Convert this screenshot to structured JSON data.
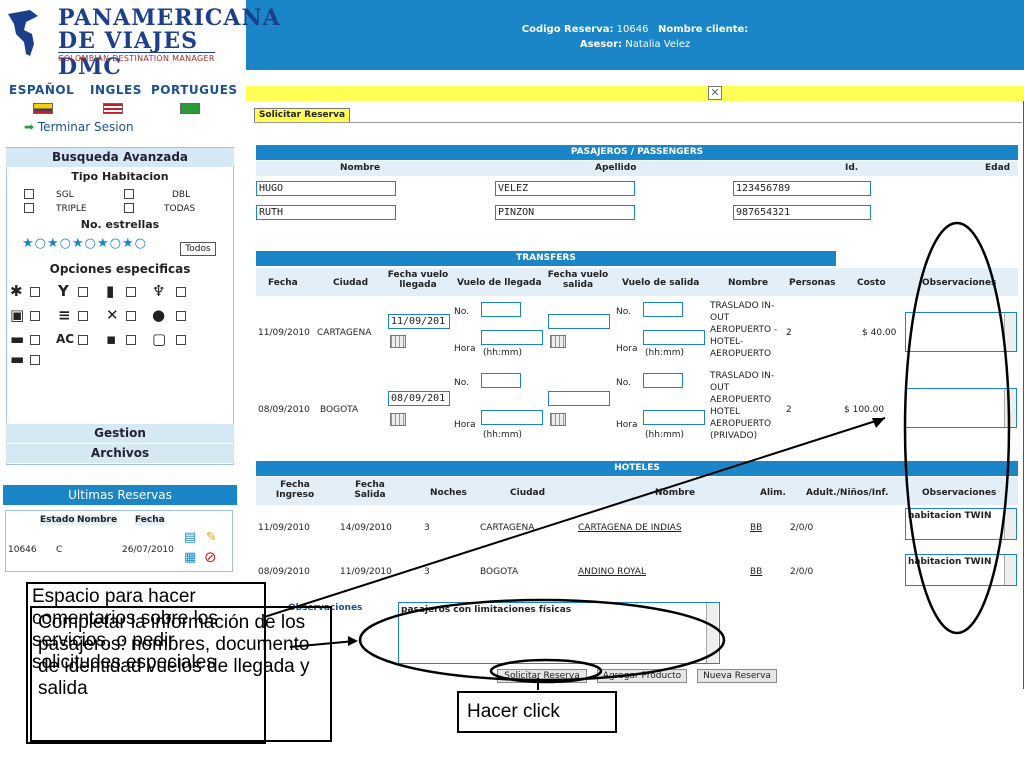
{
  "logo": {
    "line1": "PANAMERICANA",
    "line2": "DE VIAJES DMC",
    "line3": "COLOMBIAN DESTINATION MANAGER"
  },
  "header": {
    "codigo_label": "Codigo Reserva:",
    "codigo_value": "10646",
    "cliente_label": "Nombre cliente:",
    "asesor_label": "Asesor:",
    "asesor_value": "Natalia Velez"
  },
  "languages": [
    "ESPAÑOL",
    "INGLES",
    "PORTUGUES"
  ],
  "terminar": "Terminar Sesion",
  "busqueda": {
    "title": "Busqueda Avanzada",
    "tipo": "Tipo Habitacion",
    "sgl": "SGL",
    "dbl": "DBL",
    "triple": "TRIPLE",
    "todas": "TODAS",
    "estrellas": "No. estrellas",
    "todos": "Todos",
    "opciones": "Opciones especificas",
    "ac": "AC"
  },
  "gestion": "Gestion",
  "archivos": "Archivos",
  "ultimas": {
    "title": "Ultimas Reservas",
    "h_estado": "Estado",
    "h_nombre": "Nombre",
    "h_fecha": "Fecha",
    "id": "10646",
    "estado": "C",
    "fecha": "26/07/2010"
  },
  "tab": "Solicitar Reserva",
  "pasajeros": {
    "title": "PASAJEROS / PASSENGERS",
    "h_nombre": "Nombre",
    "h_apellido": "Apellido",
    "h_id": "Id.",
    "h_edad": "Edad",
    "rows": [
      {
        "nombre": "HUGO",
        "apellido": "VELEZ",
        "id": "123456789"
      },
      {
        "nombre": "RUTH",
        "apellido": "PINZON",
        "id": "987654321"
      }
    ]
  },
  "transfers": {
    "title": "TRANSFERS",
    "headers": [
      "Fecha",
      "Ciudad",
      "Fecha vuelo llegada",
      "Vuelo de llegada",
      "Fecha vuelo salida",
      "Vuelo de salida",
      "Nombre",
      "Personas",
      "Costo",
      "Observaciones"
    ],
    "no": "No.",
    "hora": "Hora",
    "hhmm": "(hh:mm)",
    "rows": [
      {
        "fecha": "11/09/2010",
        "ciudad": "CARTAGENA",
        "fecha_llegada": "11/09/201",
        "nombre": "TRASLADO IN-OUT AEROPUERTO -HOTEL-AEROPUERTO",
        "personas": "2",
        "costo": "$ 40.00"
      },
      {
        "fecha": "08/09/2010",
        "ciudad": "BOGOTA",
        "fecha_llegada": "08/09/201",
        "nombre": "TRASLADO IN-OUT AEROPUERTO HOTEL AEROPUERTO (PRIVADO)",
        "personas": "2",
        "costo": "$ 100.00"
      }
    ]
  },
  "hoteles": {
    "title": "HOTELES",
    "headers": [
      "Fecha Ingreso",
      "Fecha Salida",
      "Noches",
      "Ciudad",
      "Nombre",
      "Alim.",
      "Adult./Niños/Inf.",
      "Observaciones"
    ],
    "rows": [
      {
        "ingreso": "11/09/2010",
        "salida": "14/09/2010",
        "noches": "3",
        "ciudad": "CARTAGENA",
        "nombre": "CARTAGENA DE INDIAS",
        "alim": "BB",
        "pax": "2/0/0",
        "obs": "habitacion TWIN"
      },
      {
        "ingreso": "08/09/2010",
        "salida": "11/09/2010",
        "noches": "3",
        "ciudad": "BOGOTA",
        "nombre": "ANDINO ROYAL",
        "alim": "BB",
        "pax": "2/0/0",
        "obs": "habitacion TWIN"
      }
    ]
  },
  "observaciones": {
    "label": "Observaciones",
    "value": "pasajeros con limitaciones físicas"
  },
  "buttons": {
    "solicitar": "Solicitar Reserva",
    "agregar": "Agregar Producto",
    "nueva": "Nueva Reserva"
  },
  "notes": {
    "comentarios": "Espacio para hacer comentarios sobre los servicios, o pedir solicitudes especiales",
    "completar": "Completar la información de los pasajeros: nombres, documento de identidad vuelos de llegada y salida",
    "click": "Hacer click"
  },
  "colors": {
    "accent": "#1a86c8",
    "yellow": "#ffff55"
  }
}
